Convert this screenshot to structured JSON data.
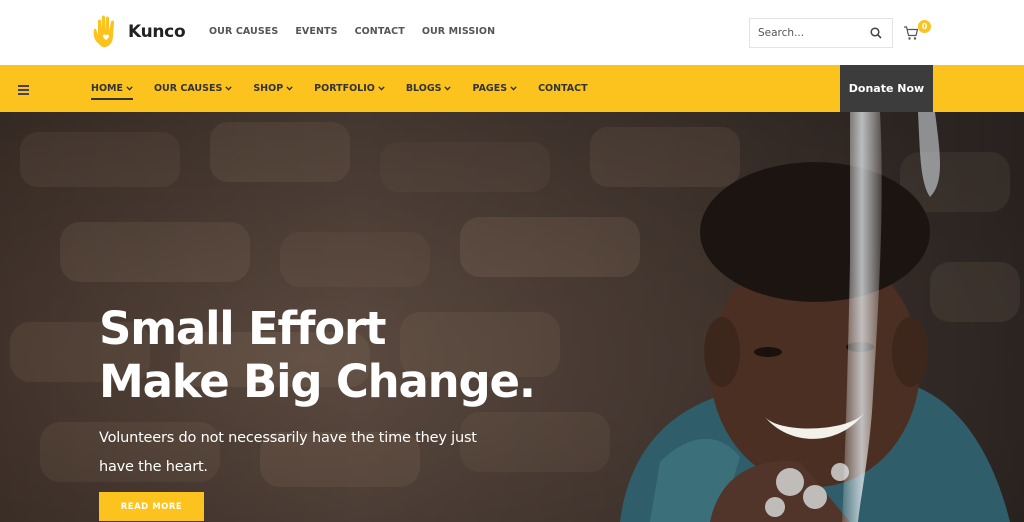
{
  "brand": {
    "name": "Kunco",
    "logo_icon": "hand-heart-icon",
    "accent": "#fcc31e",
    "dark": "#3c3c3c"
  },
  "topnav": {
    "items": [
      "OUR CAUSES",
      "EVENTS",
      "CONTACT",
      "OUR MISSION"
    ]
  },
  "search": {
    "placeholder": "Search...",
    "icon": "search-icon"
  },
  "cart": {
    "icon": "cart-icon",
    "count": "0"
  },
  "mainnav": {
    "menu_icon": "hamburger-icon",
    "items": [
      {
        "label": "HOME",
        "dropdown": true,
        "active": true
      },
      {
        "label": "OUR CAUSES",
        "dropdown": true
      },
      {
        "label": "SHOP",
        "dropdown": true
      },
      {
        "label": "PORTFOLIO",
        "dropdown": true
      },
      {
        "label": "BLOGS",
        "dropdown": true
      },
      {
        "label": "PAGES",
        "dropdown": true
      },
      {
        "label": "CONTACT",
        "dropdown": false
      }
    ],
    "donate_label": "Donate Now"
  },
  "hero": {
    "title_line1": "Small Effort",
    "title_line2": "Make Big Change.",
    "subtitle": "Volunteers do not necessarily have the time they just have the heart.",
    "button_label": "READ MORE"
  }
}
